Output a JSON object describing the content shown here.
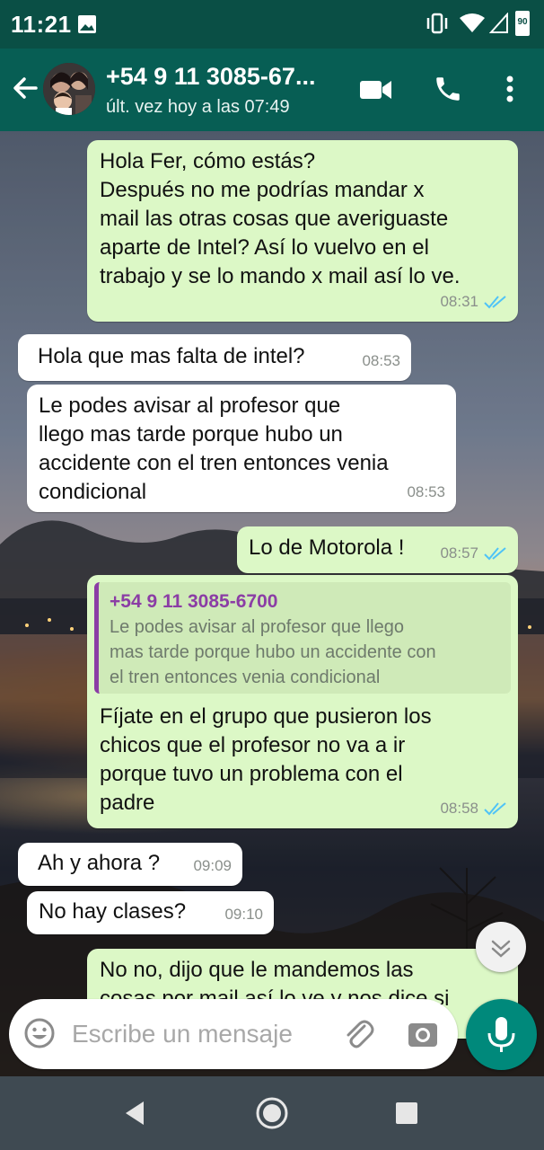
{
  "status_bar": {
    "time": "11:21",
    "battery": "90"
  },
  "header": {
    "contact_name": "+54 9 11 3085-67...",
    "last_seen": "últ. vez hoy a las 07:49"
  },
  "messages": [
    {
      "dir": "out",
      "text": "Hola Fer, cómo estás?\nDespués no me podrías mandar x\nmail las otras cosas que averiguaste\naparte de Intel? Así lo vuelvo en el\ntrabajo y se lo mando x mail así lo ve.",
      "time": "08:31"
    },
    {
      "dir": "in",
      "text": "Hola que mas falta de intel?",
      "time": "08:53"
    },
    {
      "dir": "in",
      "text": "Le podes avisar al profesor que\nllego mas tarde porque hubo un\naccidente con el tren entonces venia\ncondicional",
      "time": "08:53"
    },
    {
      "dir": "out",
      "text": "Lo de Motorola !",
      "time": "08:57"
    },
    {
      "dir": "out",
      "quote_author": "+54 9 11 3085-6700",
      "quote_text": "Le podes avisar al profesor que llego\nmas tarde porque hubo un accidente con\nel tren entonces venia condicional",
      "text": "Fíjate en el grupo que pusieron los\nchicos que el profesor no va a ir\nporque tuvo un problema con el\npadre",
      "time": "08:58"
    },
    {
      "dir": "in",
      "text": "Ah y ahora ?",
      "time": "09:09"
    },
    {
      "dir": "in",
      "text": "No hay clases?",
      "time": "09:10"
    },
    {
      "dir": "out",
      "text": "No no, dijo que le mandemos las\ncosas por mail así lo ve y nos dice si"
    }
  ],
  "composer": {
    "placeholder": "Escribe un mensaje"
  },
  "colors": {
    "header": "#075e54",
    "status_bar": "#0a4f45",
    "outgoing": "#dcf8c6",
    "incoming": "#ffffff",
    "accent": "#00897b",
    "read_ticks": "#4fc3f7",
    "quote_bar": "#8b3da5"
  },
  "icons": [
    "back-arrow-icon",
    "video-call-icon",
    "phone-icon",
    "more-options-icon",
    "emoji-icon",
    "attach-clip-icon",
    "camera-icon",
    "mic-icon",
    "chevron-down-icon",
    "nav-back-icon",
    "nav-home-icon",
    "nav-recents-icon"
  ]
}
